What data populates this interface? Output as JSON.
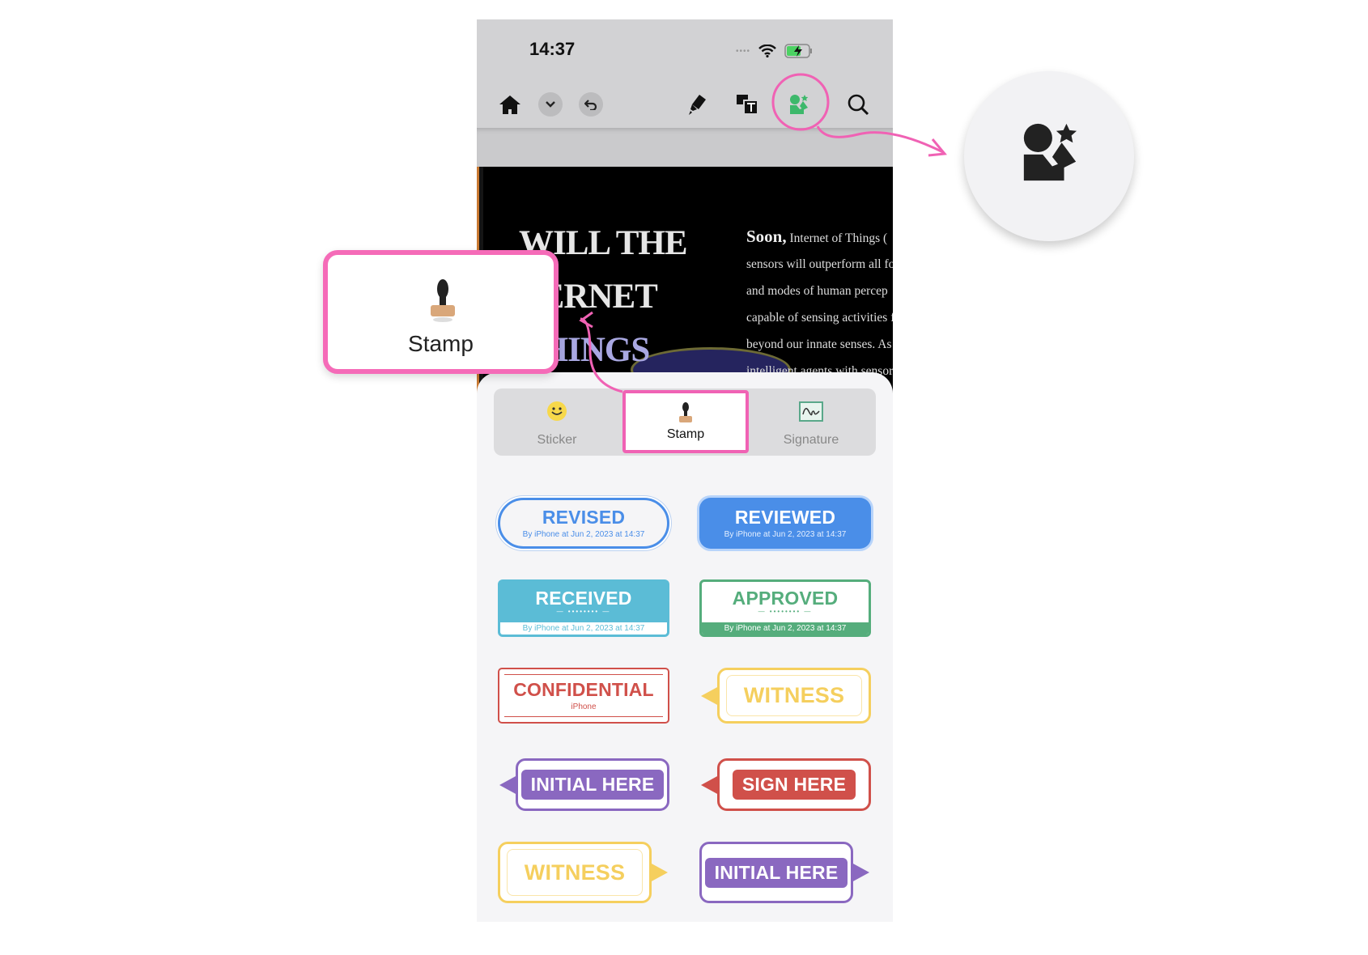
{
  "status_bar": {
    "time": "14:37"
  },
  "toolbar": {
    "icons": [
      "home-icon",
      "chevron-down-icon",
      "undo-icon",
      "highlighter-icon",
      "image-text-icon",
      "sticker-stamp-icon",
      "search-icon"
    ],
    "active": "sticker-stamp-icon",
    "active_color": "#3db86b"
  },
  "document": {
    "title_lines": [
      "WILL THE",
      "TERNET",
      "THINGS"
    ],
    "lead": "Soon,",
    "paragraph": [
      "Internet of Things (",
      "sensors will outperform all fo",
      "and modes of  human percep",
      "capable of sensing activities f",
      "beyond our innate senses. As",
      "intelligent agents with sensor"
    ]
  },
  "callout": {
    "label": "Stamp"
  },
  "tabs": [
    {
      "label": "Sticker",
      "icon": "smiley-sticker-icon"
    },
    {
      "label": "Stamp",
      "icon": "stamp-icon",
      "selected": true
    },
    {
      "label": "Signature",
      "icon": "signature-icon"
    }
  ],
  "stamps": [
    {
      "label": "REVISED",
      "sub": "By iPhone at Jun 2, 2023 at 14:37",
      "style": "pill-outline",
      "color": "#4a8ee8"
    },
    {
      "label": "REVIEWED",
      "sub": "By iPhone at Jun 2, 2023 at 14:37",
      "style": "pill-filled",
      "color": "#4a8ee8"
    },
    {
      "label": "RECEIVED",
      "sub": "By iPhone at Jun 2, 2023 at 14:37",
      "style": "band-filled",
      "color": "#5bbcd6"
    },
    {
      "label": "APPROVED",
      "sub": "By iPhone at Jun 2, 2023 at 14:37",
      "style": "band-outline",
      "color": "#55ad7c"
    },
    {
      "label": "CONFIDENTIAL",
      "sub": "iPhone",
      "style": "rect-outline",
      "color": "#d0504a"
    },
    {
      "label": "WITNESS",
      "sub": "",
      "style": "pointer-left-outline",
      "color": "#f5cf5e"
    },
    {
      "label": "INITIAL HERE",
      "sub": "",
      "style": "pointer-left-filled",
      "color": "#8a68c0"
    },
    {
      "label": "SIGN HERE",
      "sub": "",
      "style": "pointer-left-filled",
      "color": "#d0504a"
    },
    {
      "label": "WITNESS",
      "sub": "",
      "style": "pointer-right-outline",
      "color": "#f5cf5e"
    },
    {
      "label": "INITIAL HERE",
      "sub": "",
      "style": "pointer-right-filled",
      "color": "#8a68c0"
    }
  ],
  "accent": "#f062b4"
}
